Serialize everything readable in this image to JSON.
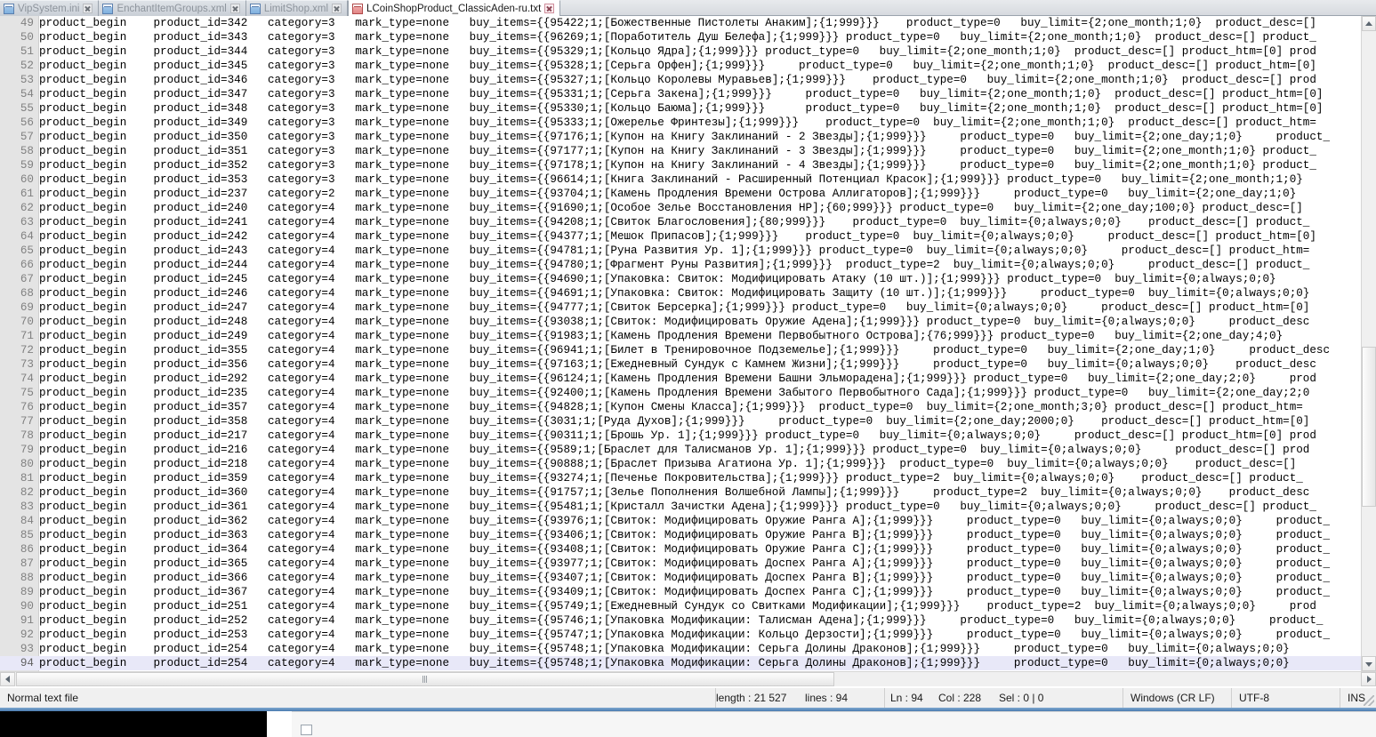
{
  "window": {
    "app": "Notepad++",
    "tabs": [
      {
        "label": "VipSystem.ini",
        "icon": "document-icon-blue",
        "active": false
      },
      {
        "label": "EnchantItemGroups.xml",
        "icon": "document-icon-blue",
        "active": false
      },
      {
        "label": "LimitShop.xml",
        "icon": "document-icon-blue",
        "active": false
      },
      {
        "label": "LCoinShopProduct_ClassicAden-ru.txt",
        "icon": "document-icon-red",
        "active": true
      }
    ]
  },
  "statusbar": {
    "file_type": "Normal text file",
    "length_label": "length : 21 527",
    "lines_label": "lines : 94",
    "ln_label": "Ln : 94",
    "col_label": "Col : 228",
    "sel_label": "Sel : 0 | 0",
    "eol": "Windows (CR LF)",
    "encoding": "UTF-8",
    "insert_mode": "INS"
  },
  "scrollbars": {
    "vertical_position_pct": 52,
    "horizontal_position_pct": 2
  },
  "editor": {
    "current_line": 94,
    "first_visible_line": 49,
    "lines": [
      {
        "n": 49,
        "text": "product_begin    product_id=342   category=3   mark_type=none   buy_items={{95422;1;[Божественные Пистолеты Анаким];{1;999}}}    product_type=0   buy_limit={2;one_month;1;0}  product_desc=[]"
      },
      {
        "n": 50,
        "text": "product_begin    product_id=343   category=3   mark_type=none   buy_items={{96269;1;[Поработитель Душ Белефа];{1;999}}} product_type=0   buy_limit={2;one_month;1;0}  product_desc=[] product_"
      },
      {
        "n": 51,
        "text": "product_begin    product_id=344   category=3   mark_type=none   buy_items={{95329;1;[Кольцо Ядра];{1;999}}} product_type=0   buy_limit={2;one_month;1;0}  product_desc=[] product_htm=[0] prod"
      },
      {
        "n": 52,
        "text": "product_begin    product_id=345   category=3   mark_type=none   buy_items={{95328;1;[Серьга Орфен];{1;999}}}     product_type=0   buy_limit={2;one_month;1;0}  product_desc=[] product_htm=[0]"
      },
      {
        "n": 53,
        "text": "product_begin    product_id=346   category=3   mark_type=none   buy_items={{95327;1;[Кольцо Королевы Муравьев];{1;999}}}    product_type=0   buy_limit={2;one_month;1;0}  product_desc=[] prod"
      },
      {
        "n": 54,
        "text": "product_begin    product_id=347   category=3   mark_type=none   buy_items={{95331;1;[Серьга Закена];{1;999}}}     product_type=0   buy_limit={2;one_month;1;0}  product_desc=[] product_htm=[0]"
      },
      {
        "n": 55,
        "text": "product_begin    product_id=348   category=3   mark_type=none   buy_items={{95330;1;[Кольцо Баюма];{1;999}}}      product_type=0   buy_limit={2;one_month;1;0}  product_desc=[] product_htm=[0]"
      },
      {
        "n": 56,
        "text": "product_begin    product_id=349   category=3   mark_type=none   buy_items={{95333;1;[Ожерелье Фринтезы];{1;999}}}    product_type=0  buy_limit={2;one_month;1;0}  product_desc=[] product_htm="
      },
      {
        "n": 57,
        "text": "product_begin    product_id=350   category=3   mark_type=none   buy_items={{97176;1;[Купон на Книгу Заклинаний - 2 Звезды];{1;999}}}     product_type=0   buy_limit={2;one_day;1;0}     product_"
      },
      {
        "n": 58,
        "text": "product_begin    product_id=351   category=3   mark_type=none   buy_items={{97177;1;[Купон на Книгу Заклинаний - 3 Звезды];{1;999}}}     product_type=0   buy_limit={2;one_month;1;0} product_"
      },
      {
        "n": 59,
        "text": "product_begin    product_id=352   category=3   mark_type=none   buy_items={{97178;1;[Купон на Книгу Заклинаний - 4 Звезды];{1;999}}}     product_type=0   buy_limit={2;one_month;1;0} product_"
      },
      {
        "n": 60,
        "text": "product_begin    product_id=353   category=3   mark_type=none   buy_items={{96614;1;[Книга Заклинаний - Расширенный Потенциал Красок];{1;999}}} product_type=0   buy_limit={2;one_month;1;0}"
      },
      {
        "n": 61,
        "text": "product_begin    product_id=237   category=2   mark_type=none   buy_items={{93704;1;[Камень Продления Времени Острова Аллигаторов];{1;999}}}     product_type=0   buy_limit={2;one_day;1;0}"
      },
      {
        "n": 62,
        "text": "product_begin    product_id=240   category=4   mark_type=none   buy_items={{91690;1;[Особое Зелье Восстановления HP];{60;999}}} product_type=0   buy_limit={2;one_day;100;0} product_desc=[]"
      },
      {
        "n": 63,
        "text": "product_begin    product_id=241   category=4   mark_type=none   buy_items={{94208;1;[Свиток Благословения];{80;999}}}    product_type=0  buy_limit={0;always;0;0}    product_desc=[] product_"
      },
      {
        "n": 64,
        "text": "product_begin    product_id=242   category=4   mark_type=none   buy_items={{94377;1;[Мешок Припасов];{1;999}}}    product_type=0  buy_limit={0;always;0;0}     product_desc=[] product_htm=[0]"
      },
      {
        "n": 65,
        "text": "product_begin    product_id=243   category=4   mark_type=none   buy_items={{94781;1;[Руна Развития Ур. 1];{1;999}}} product_type=0  buy_limit={0;always;0;0}     product_desc=[] product_htm="
      },
      {
        "n": 66,
        "text": "product_begin    product_id=244   category=4   mark_type=none   buy_items={{94780;1;[Фрагмент Руны Развития];{1;999}}}  product_type=2  buy_limit={0;always;0;0}     product_desc=[] product_"
      },
      {
        "n": 67,
        "text": "product_begin    product_id=245   category=4   mark_type=none   buy_items={{94690;1;[Упаковка: Свиток: Модифицировать Атаку (10 шт.)];{1;999}}} product_type=0  buy_limit={0;always;0;0}"
      },
      {
        "n": 68,
        "text": "product_begin    product_id=246   category=4   mark_type=none   buy_items={{94691;1;[Упаковка: Свиток: Модифицировать Защиту (10 шт.)];{1;999}}}     product_type=0  buy_limit={0;always;0;0}"
      },
      {
        "n": 69,
        "text": "product_begin    product_id=247   category=4   mark_type=none   buy_items={{94777;1;[Свиток Берсерка];{1;999}}} product_type=0   buy_limit={0;always;0;0}     product_desc=[] product_htm=[0]"
      },
      {
        "n": 70,
        "text": "product_begin    product_id=248   category=4   mark_type=none   buy_items={{93038;1;[Свиток: Модифицировать Оружие Адена];{1;999}}} product_type=0  buy_limit={0;always;0;0}     product_desc"
      },
      {
        "n": 71,
        "text": "product_begin    product_id=249   category=4   mark_type=none   buy_items={{91983;1;[Камень Продления Времени Первобытного Острова];{76;999}}} product_type=0   buy_limit={2;one_day;4;0}"
      },
      {
        "n": 72,
        "text": "product_begin    product_id=355   category=4   mark_type=none   buy_items={{96941;1;[Билет в Тренировочное Подземелье];{1;999}}}     product_type=0   buy_limit={2;one_day;1;0}     product_desc"
      },
      {
        "n": 73,
        "text": "product_begin    product_id=356   category=4   mark_type=none   buy_items={{97163;1;[Ежедневный Сундук с Камнем Жизни];{1;999}}}     product_type=0   buy_limit={0;always;0;0}    product_desc"
      },
      {
        "n": 74,
        "text": "product_begin    product_id=292   category=4   mark_type=none   buy_items={{96124;1;[Камень Продления Времени Башни Эльморадена];{1;999}}} product_type=0   buy_limit={2;one_day;2;0}     prod"
      },
      {
        "n": 75,
        "text": "product_begin    product_id=235   category=4   mark_type=none   buy_items={{92400;1;[Камень Продления Времени Забытого Первобытного Сада];{1;999}}} product_type=0   buy_limit={2;one_day;2;0"
      },
      {
        "n": 76,
        "text": "product_begin    product_id=357   category=4   mark_type=none   buy_items={{94828;1;[Купон Смены Класса];{1;999}}}  product_type=0  buy_limit={2;one_month;3;0} product_desc=[] product_htm="
      },
      {
        "n": 77,
        "text": "product_begin    product_id=358   category=4   mark_type=none   buy_items={{3031;1;[Руда Духов];{1;999}}}     product_type=0  buy_limit={2;one_day;2000;0}    product_desc=[] product_htm=[0]"
      },
      {
        "n": 78,
        "text": "product_begin    product_id=217   category=4   mark_type=none   buy_items={{90311;1;[Брошь Ур. 1];{1;999}}} product_type=0   buy_limit={0;always;0;0}     product_desc=[] product_htm=[0] prod"
      },
      {
        "n": 79,
        "text": "product_begin    product_id=216   category=4   mark_type=none   buy_items={{9589;1;[Браслет для Талисманов Ур. 1];{1;999}}} product_type=0  buy_limit={0;always;0;0}     product_desc=[] prod"
      },
      {
        "n": 80,
        "text": "product_begin    product_id=218   category=4   mark_type=none   buy_items={{90888;1;[Браслет Призыва Агатиона Ур. 1];{1;999}}}  product_type=0  buy_limit={0;always;0;0}    product_desc=[]"
      },
      {
        "n": 81,
        "text": "product_begin    product_id=359   category=4   mark_type=none   buy_items={{93274;1;[Печенье Покровительства];{1;999}}} product_type=2  buy_limit={0;always;0;0}    product_desc=[] product_"
      },
      {
        "n": 82,
        "text": "product_begin    product_id=360   category=4   mark_type=none   buy_items={{91757;1;[Зелье Пополнения Волшебной Лампы];{1;999}}}     product_type=2  buy_limit={0;always;0;0}    product_desc"
      },
      {
        "n": 83,
        "text": "product_begin    product_id=361   category=4   mark_type=none   buy_items={{95481;1;[Кристалл Зачистки Адена];{1;999}}} product_type=0   buy_limit={0;always;0;0}     product_desc=[] product_"
      },
      {
        "n": 84,
        "text": "product_begin    product_id=362   category=4   mark_type=none   buy_items={{93976;1;[Свиток: Модифицировать Оружие Ранга A];{1;999}}}     product_type=0   buy_limit={0;always;0;0}     product_"
      },
      {
        "n": 85,
        "text": "product_begin    product_id=363   category=4   mark_type=none   buy_items={{93406;1;[Свиток: Модифицировать Оружие Ранга B];{1;999}}}     product_type=0   buy_limit={0;always;0;0}     product_"
      },
      {
        "n": 86,
        "text": "product_begin    product_id=364   category=4   mark_type=none   buy_items={{93408;1;[Свиток: Модифицировать Оружие Ранга C];{1;999}}}     product_type=0   buy_limit={0;always;0;0}     product_"
      },
      {
        "n": 87,
        "text": "product_begin    product_id=365   category=4   mark_type=none   buy_items={{93977;1;[Свиток: Модифицировать Доспех Ранга A];{1;999}}}     product_type=0   buy_limit={0;always;0;0}     product_"
      },
      {
        "n": 88,
        "text": "product_begin    product_id=366   category=4   mark_type=none   buy_items={{93407;1;[Свиток: Модифицировать Доспех Ранга B];{1;999}}}     product_type=0   buy_limit={0;always;0;0}     product_"
      },
      {
        "n": 89,
        "text": "product_begin    product_id=367   category=4   mark_type=none   buy_items={{93409;1;[Свиток: Модифицировать Доспех Ранга C];{1;999}}}     product_type=0   buy_limit={0;always;0;0}     product_"
      },
      {
        "n": 90,
        "text": "product_begin    product_id=251   category=4   mark_type=none   buy_items={{95749;1;[Ежедневный Сундук со Свитками Модификации];{1;999}}}    product_type=2  buy_limit={0;always;0;0}     prod"
      },
      {
        "n": 91,
        "text": "product_begin    product_id=252   category=4   mark_type=none   buy_items={{95746;1;[Упаковка Модификации: Талисман Адена];{1;999}}}     product_type=0   buy_limit={0;always;0;0}     product_"
      },
      {
        "n": 92,
        "text": "product_begin    product_id=253   category=4   mark_type=none   buy_items={{95747;1;[Упаковка Модификации: Кольцо Дерзости];{1;999}}}     product_type=0   buy_limit={0;always;0;0}     product_"
      },
      {
        "n": 93,
        "text": "product_begin    product_id=254   category=4   mark_type=none   buy_items={{95748;1;[Упаковка Модификации: Серьга Долины Драконов];{1;999}}}     product_type=0   buy_limit={0;always;0;0}"
      },
      {
        "n": 94,
        "text": "product_begin    product_id=254   category=4   mark_type=none   buy_items={{95748;1;[Упаковка Модификации: Серьга Долины Драконов];{1;999}}}     product_type=0   buy_limit={0;always;0;0}"
      }
    ]
  }
}
